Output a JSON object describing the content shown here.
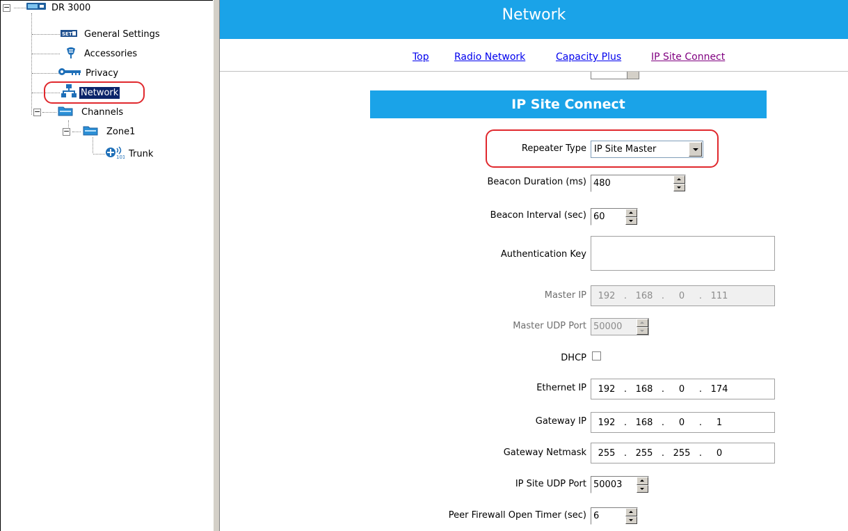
{
  "tree": {
    "root": "DR 3000",
    "items": [
      {
        "label": "General Settings",
        "icon": "general-settings-icon"
      },
      {
        "label": "Accessories",
        "icon": "accessories-icon"
      },
      {
        "label": "Privacy",
        "icon": "key-icon"
      },
      {
        "label": "Network",
        "icon": "network-icon"
      },
      {
        "label": "Channels",
        "icon": "folder-icon"
      },
      {
        "label": "Zone1",
        "icon": "folder-icon"
      },
      {
        "label": "Trunk",
        "icon": "trunk-icon"
      }
    ],
    "expanders": [
      "−",
      "−",
      "−"
    ],
    "selected": "Network"
  },
  "header": {
    "title": "Network"
  },
  "nav": {
    "links": [
      "Top",
      "Radio Network",
      "Capacity Plus",
      "IP Site Connect"
    ]
  },
  "section": {
    "title": "IP Site Connect"
  },
  "form": {
    "repeater_type": {
      "label": "Repeater Type",
      "value": "IP Site Master"
    },
    "beacon_duration": {
      "label": "Beacon Duration (ms)",
      "value": "480"
    },
    "beacon_interval": {
      "label": "Beacon Interval (sec)",
      "value": "60"
    },
    "auth_key": {
      "label": "Authentication Key",
      "value": ""
    },
    "master_ip": {
      "label": "Master IP",
      "octets": [
        "192",
        "168",
        "0",
        "111"
      ]
    },
    "master_udp": {
      "label": "Master UDP Port",
      "value": "50000"
    },
    "dhcp": {
      "label": "DHCP",
      "checked": false
    },
    "ethernet_ip": {
      "label": "Ethernet IP",
      "octets": [
        "192",
        "168",
        "0",
        "174"
      ]
    },
    "gateway_ip": {
      "label": "Gateway IP",
      "octets": [
        "192",
        "168",
        "0",
        "1"
      ]
    },
    "gateway_netmask": {
      "label": "Gateway Netmask",
      "octets": [
        "255",
        "255",
        "255",
        "0"
      ]
    },
    "ip_site_udp": {
      "label": "IP Site UDP Port",
      "value": "50003"
    },
    "peer_firewall": {
      "label": "Peer Firewall Open Timer (sec)",
      "value": "6"
    }
  },
  "colors": {
    "accent": "#1aa3e8",
    "highlight": "#e0282d",
    "selection": "#0a246a"
  }
}
